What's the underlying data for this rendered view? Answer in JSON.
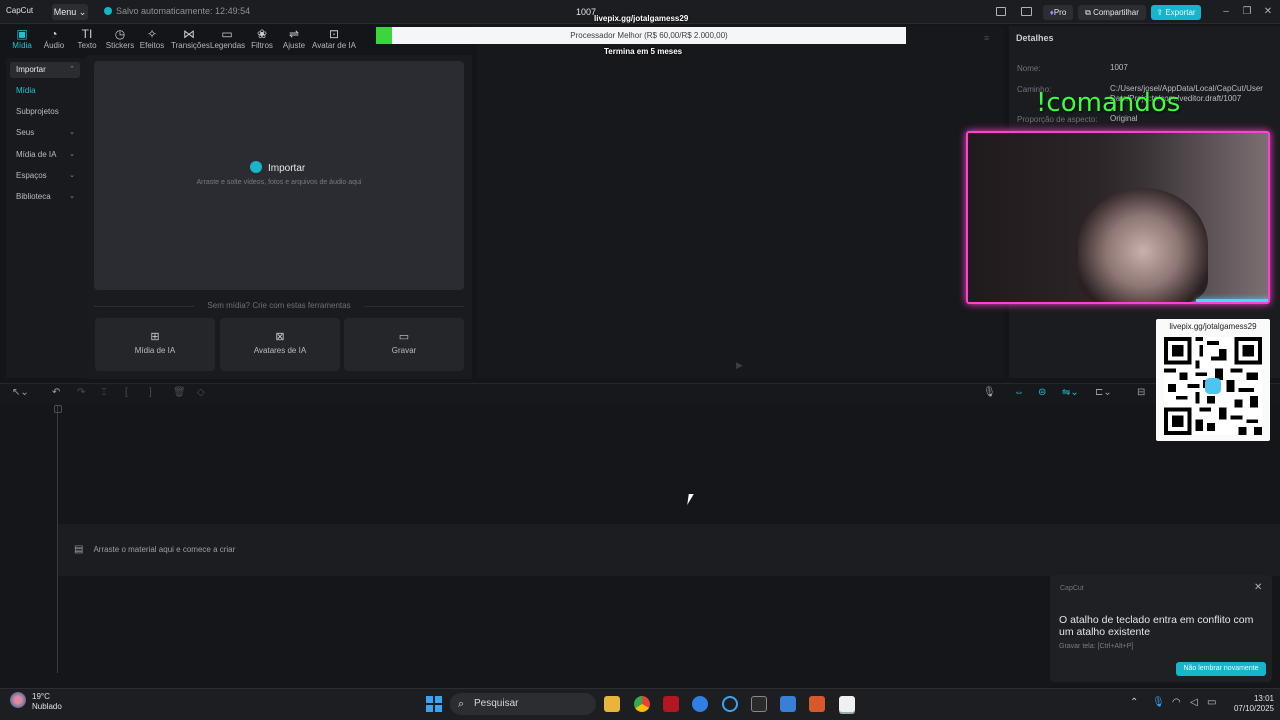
{
  "titlebar": {
    "app_name": "CapCut",
    "menu_label": "Menu ⌄",
    "autosave": "Salvo automaticamente: 12:49:54",
    "project_title": "1007",
    "pro_label": "Pro",
    "share_label": "Compartilhar",
    "export_label": "Exportar"
  },
  "overlay": {
    "livepix_top": "livepix.gg/jotalgamess29",
    "processor_text": "Processador Melhor (R$ 60,00/R$ 2.000,00)",
    "processor_progress": 0.03,
    "ends_in": "Termina em 5 meses",
    "commands": "!comandos",
    "qr_label": "livepix.gg/jotalgamess29"
  },
  "toolbar": {
    "items": [
      {
        "label": "Mídia",
        "icon": "media-icon"
      },
      {
        "label": "Áudio",
        "icon": "audio-icon"
      },
      {
        "label": "Texto",
        "icon": "text-icon"
      },
      {
        "label": "Stickers",
        "icon": "sticker-icon"
      },
      {
        "label": "Efeitos",
        "icon": "effects-icon"
      },
      {
        "label": "Transições",
        "icon": "transitions-icon"
      },
      {
        "label": "Legendas",
        "icon": "captions-icon"
      },
      {
        "label": "Filtros",
        "icon": "filters-icon"
      },
      {
        "label": "Ajuste",
        "icon": "adjust-icon"
      },
      {
        "label": "Avatar de IA",
        "icon": "ai-avatar-icon"
      }
    ]
  },
  "leftnav": {
    "items": [
      {
        "label": "Importar"
      },
      {
        "label": "Mídia"
      },
      {
        "label": "Subprojetos"
      },
      {
        "label": "Seus"
      },
      {
        "label": "Mídia de IA"
      },
      {
        "label": "Espaços"
      },
      {
        "label": "Biblioteca"
      }
    ]
  },
  "media": {
    "import_label": "Importar",
    "import_hint": "Arraste e solte vídeos, fotos e arquivos de áudio aqui",
    "no_media": "Sem mídia? Crie com estas ferramentas",
    "cards": [
      {
        "label": "Mídia de IA"
      },
      {
        "label": "Avatares de IA"
      },
      {
        "label": "Gravar"
      }
    ]
  },
  "details": {
    "header": "Detalhes",
    "name_label": "Nome:",
    "name_value": "1007",
    "path_label": "Caminho:",
    "path_value": "C:/Users/josel/AppData/Local/CapCut/User Data/Projects/com.lveditor.draft/1007",
    "aspect_label": "Proporção de aspecto:",
    "aspect_value": "Original"
  },
  "timeline": {
    "drop_hint": "Arraste o material aqui e comece a criar"
  },
  "popup": {
    "app": "CapCut",
    "message": "O atalho de teclado entra em conflito com um atalho existente",
    "sub": "Gravar tela: [Ctrl+Alt+P]",
    "button": "Não lembrar novamente"
  },
  "taskbar": {
    "temp": "19°C",
    "weather": "Nublado",
    "search": "Pesquisar",
    "time": "13:01",
    "date": "07/10/2025"
  },
  "colors": {
    "accent": "#16b5c9",
    "neon_pink": "#ff3fd5",
    "commands_green": "#3dff3d"
  }
}
